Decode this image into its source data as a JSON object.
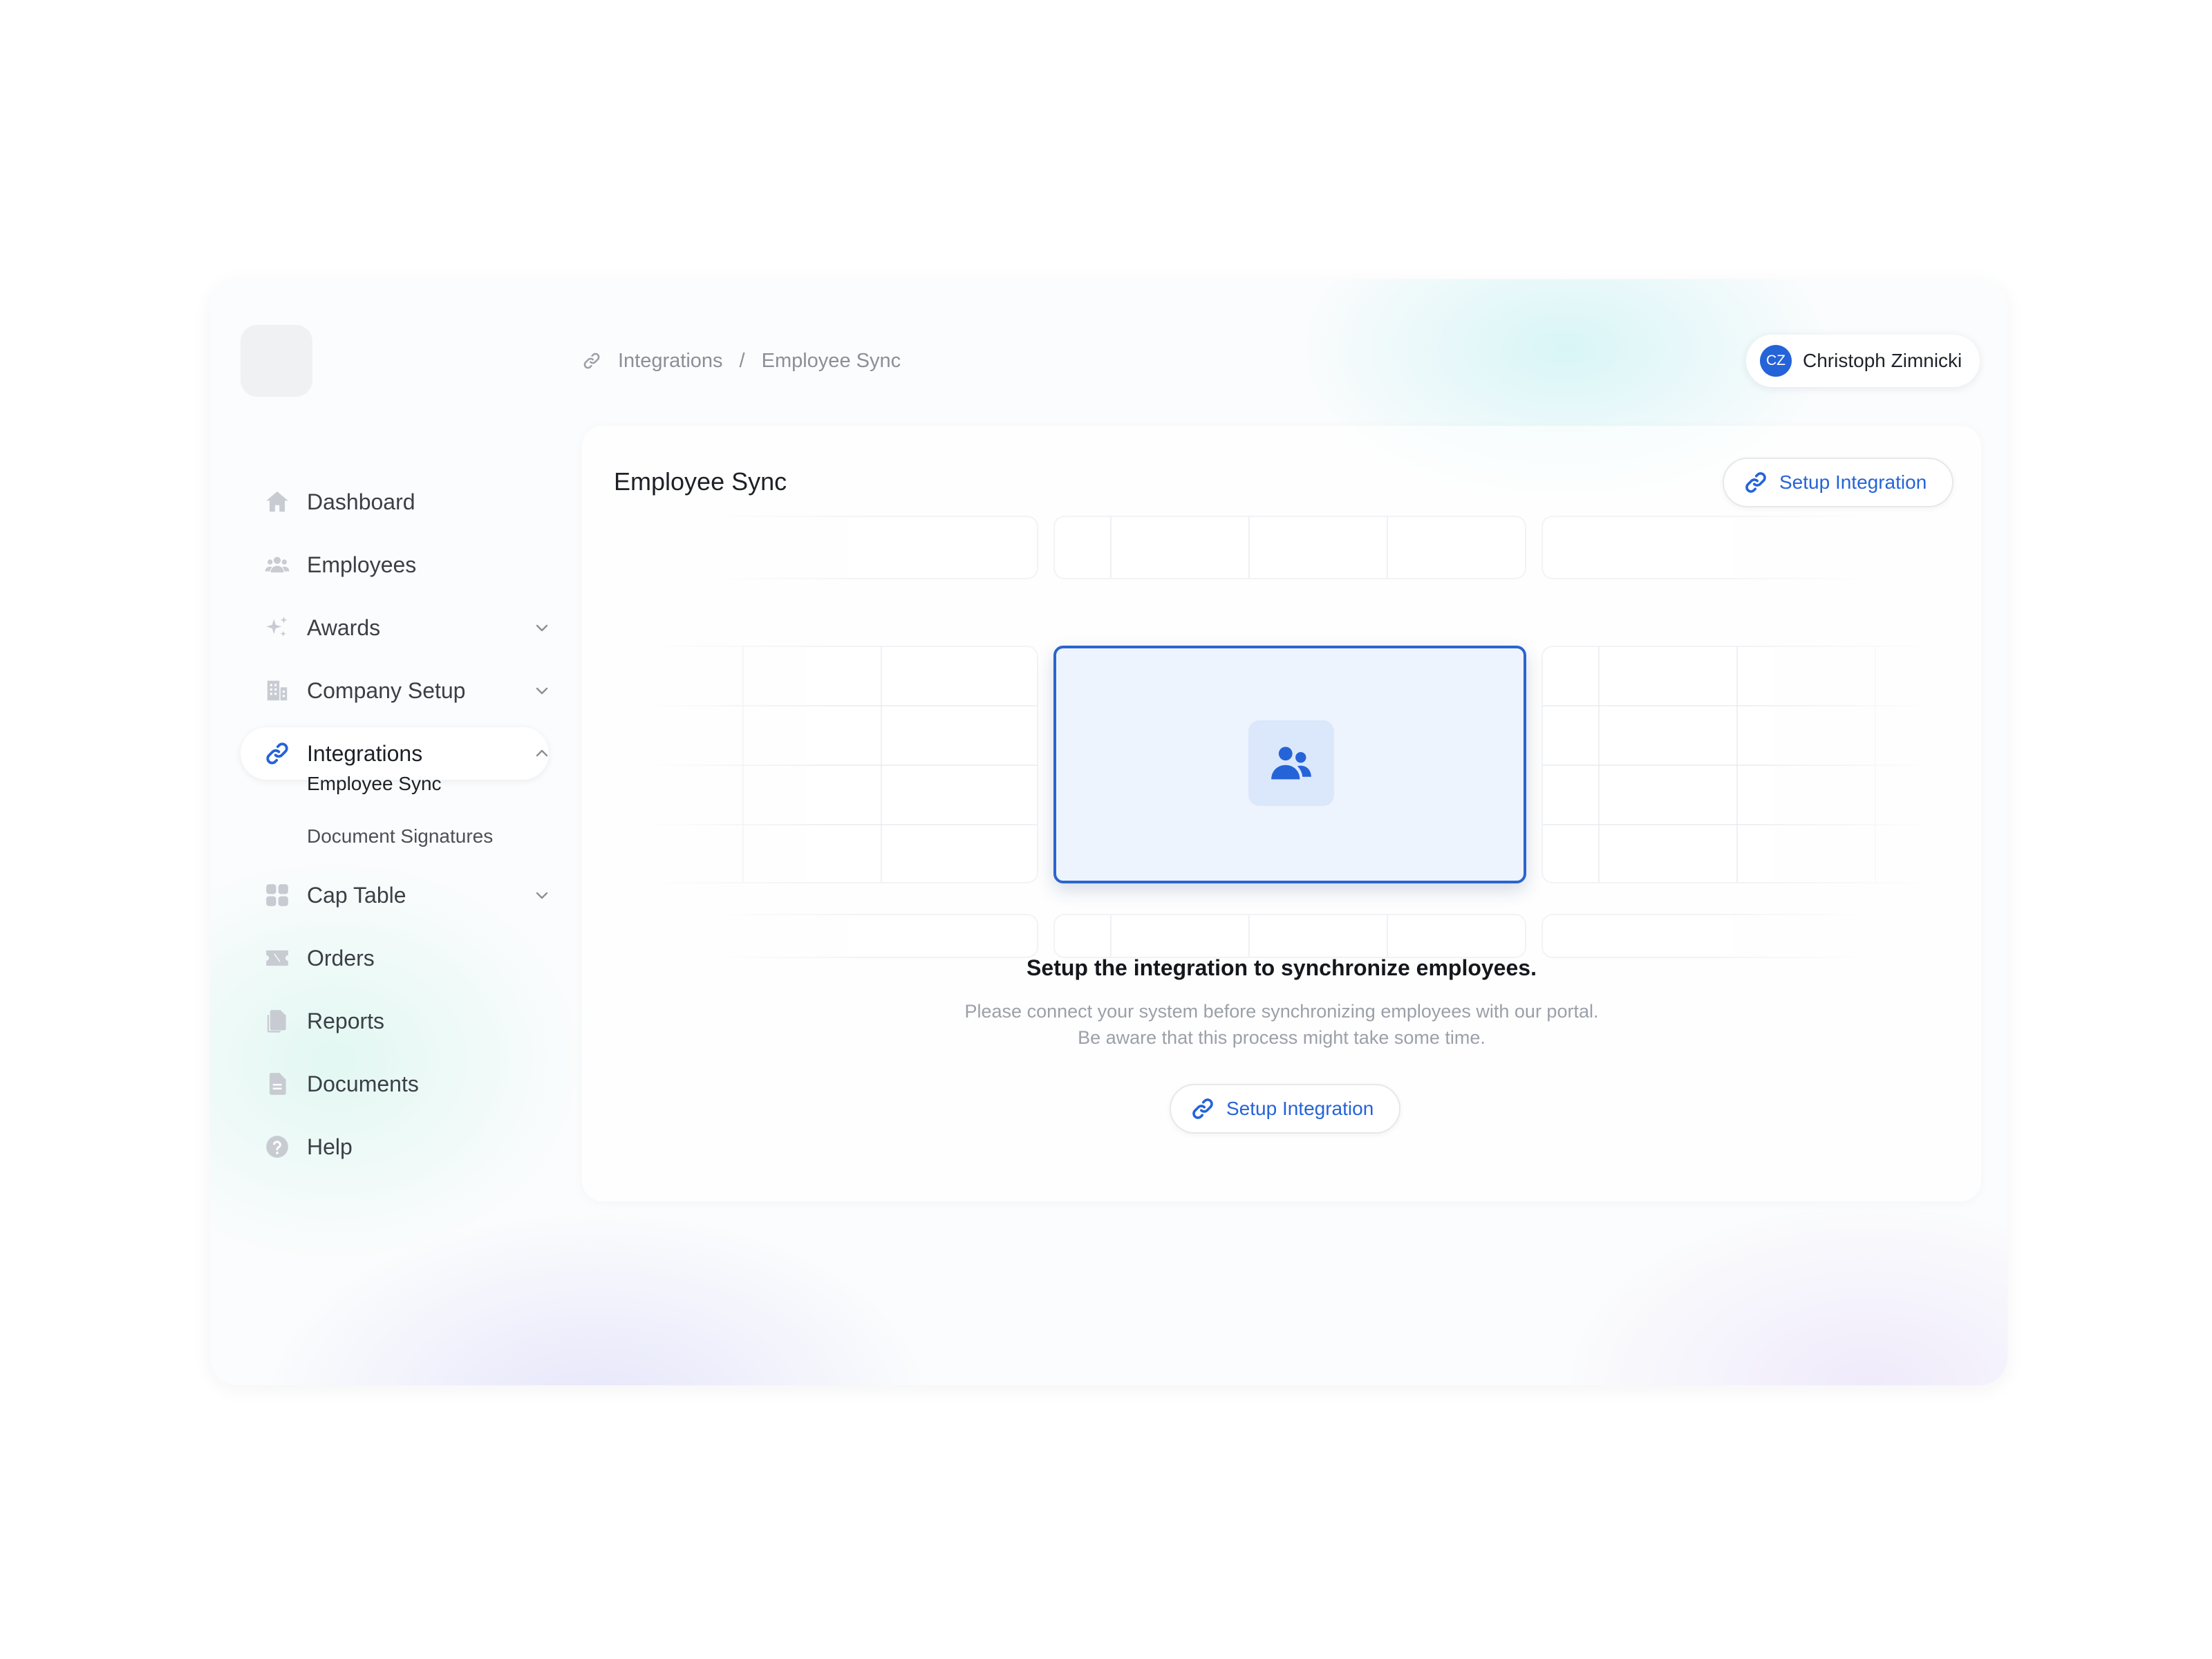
{
  "user": {
    "initials": "CZ",
    "name": "Christoph Zimnicki"
  },
  "breadcrumb": {
    "icon": "link-icon",
    "items": [
      "Integrations",
      "Employee Sync"
    ],
    "separator": "/"
  },
  "sidebar": {
    "items": [
      {
        "label": "Dashboard",
        "icon": "home-icon"
      },
      {
        "label": "Employees",
        "icon": "users-icon"
      },
      {
        "label": "Awards",
        "icon": "sparkles-icon",
        "expandable": true
      },
      {
        "label": "Company Setup",
        "icon": "building-icon",
        "expandable": true
      },
      {
        "label": "Integrations",
        "icon": "link-icon",
        "expandable": true,
        "expanded": true,
        "active": true
      },
      {
        "label": "Cap Table",
        "icon": "grid-icon",
        "expandable": true
      },
      {
        "label": "Orders",
        "icon": "ticket-icon"
      },
      {
        "label": "Reports",
        "icon": "files-icon"
      },
      {
        "label": "Documents",
        "icon": "document-icon"
      },
      {
        "label": "Help",
        "icon": "help-icon"
      }
    ],
    "integrations_subitems": [
      {
        "label": "Employee Sync",
        "current": true
      },
      {
        "label": "Document Signatures"
      }
    ]
  },
  "main": {
    "title": "Employee Sync",
    "setup_button_label": "Setup Integration",
    "empty_state": {
      "icon": "users-icon",
      "heading": "Setup the integration to synchronize employees.",
      "description_line1": "Please connect your system before synchronizing employees with our portal.",
      "description_line2": "Be aware that this process might take some time.",
      "button_label": "Setup Integration"
    }
  },
  "colors": {
    "accent": "#2563d8",
    "icon_gray": "#c8ccd2",
    "focus_border": "#2b64cf",
    "focus_fill": "#eef4fd"
  }
}
